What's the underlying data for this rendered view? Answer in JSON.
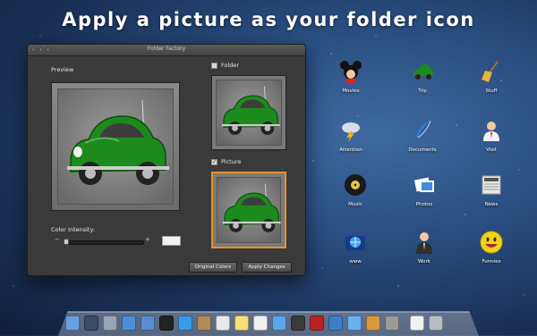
{
  "banner": {
    "text": "Apply a picture as your folder icon"
  },
  "window": {
    "title": "Folder Factory",
    "preview_label": "Preview",
    "folder_label": "Folder",
    "picture_label": "Picture",
    "color_intensity_label": "Color Intensity:",
    "minus": "−",
    "plus": "+",
    "original_colors_button": "Original Colors",
    "apply_changes_button": "Apply Changes",
    "folder_checked": false,
    "picture_checked": true,
    "intensity_value": 0.05,
    "accent": "#e8902a",
    "car_color": "#1c8a1c"
  },
  "desktop_icons": [
    {
      "label": "Movies",
      "icon": "mickey-icon"
    },
    {
      "label": "Trip",
      "icon": "car-icon"
    },
    {
      "label": "Stuff",
      "icon": "broom-icon"
    },
    {
      "label": "Attention",
      "icon": "storm-cloud-icon"
    },
    {
      "label": "Documents",
      "icon": "feather-icon"
    },
    {
      "label": "Visit",
      "icon": "person-icon"
    },
    {
      "label": "Music",
      "icon": "vinyl-icon"
    },
    {
      "label": "Photos",
      "icon": "photos-icon"
    },
    {
      "label": "News",
      "icon": "newspaper-icon"
    },
    {
      "label": "www",
      "icon": "globe-icon"
    },
    {
      "label": "Work",
      "icon": "businessman-icon"
    },
    {
      "label": "Funnies",
      "icon": "smiley-icon"
    }
  ],
  "dock": {
    "items": [
      "finder-icon",
      "dashboard-icon",
      "launchpad-icon",
      "safari-icon",
      "mail-icon",
      "clock-icon",
      "app-store-icon",
      "contacts-icon",
      "calendar-icon",
      "notes-icon",
      "reminders-icon",
      "messages-icon",
      "facetime-icon",
      "photo-booth-icon",
      "iphoto-icon",
      "itunes-icon",
      "ibooks-icon",
      "preferences-icon",
      "documents-icon",
      "trash-icon"
    ]
  }
}
